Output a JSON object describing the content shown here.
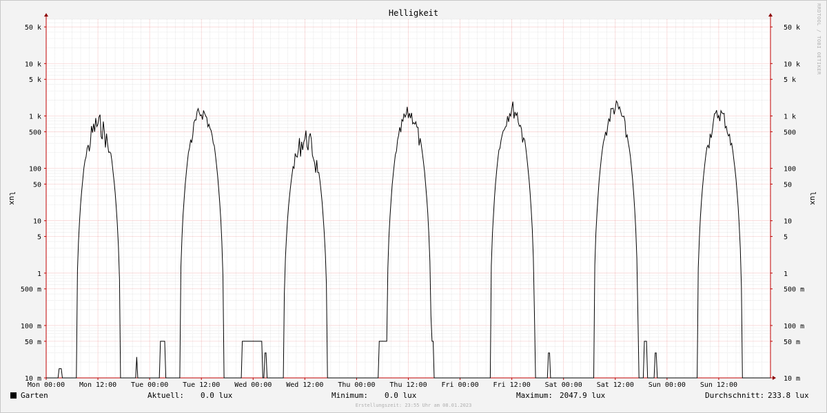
{
  "watermark": "RRDTOOL / TOBI OETIKER",
  "chart_data": {
    "type": "line",
    "title": "Helligkeit",
    "ylabel": "lux",
    "y_scale": "log",
    "ylim": [
      0.01,
      70000
    ],
    "xlim": [
      0,
      168
    ],
    "x_unit": "hours since Mon 00:00",
    "x_tick_labels": [
      "Mon 00:00",
      "Mon 12:00",
      "Tue 00:00",
      "Tue 12:00",
      "Wed 00:00",
      "Wed 12:00",
      "Thu 00:00",
      "Thu 12:00",
      "Fri 00:00",
      "Fri 12:00",
      "Sat 00:00",
      "Sat 12:00",
      "Sun 00:00",
      "Sun 12:00"
    ],
    "y_tick_labels": [
      "10 m",
      "50 m",
      "100 m",
      "500 m",
      "1",
      "5",
      "10",
      "50",
      "100",
      "500",
      "1 k",
      "5 k",
      "10 k",
      "50 k"
    ],
    "y_tick_values": [
      0.01,
      0.05,
      0.1,
      0.5,
      1,
      5,
      10,
      50,
      100,
      500,
      1000,
      5000,
      10000,
      50000
    ],
    "grid": true,
    "series": [
      {
        "name": "Garten",
        "color": "#000000",
        "days": [
          {
            "day": 0,
            "rise": 7.0,
            "set": 17.2,
            "peak": 1150,
            "noise": 0.45
          },
          {
            "day": 1,
            "rise": 7.0,
            "set": 17.2,
            "peak": 1650,
            "noise": 0.3
          },
          {
            "day": 2,
            "rise": 7.1,
            "set": 17.2,
            "peak": 600,
            "noise": 0.45
          },
          {
            "day": 3,
            "rise": 7.0,
            "set": 17.3,
            "peak": 1550,
            "noise": 0.3
          },
          {
            "day": 4,
            "rise": 7.0,
            "set": 17.3,
            "peak": 2000,
            "noise": 0.35
          },
          {
            "day": 5,
            "rise": 7.0,
            "set": 17.3,
            "peak": 2048,
            "noise": 0.3
          },
          {
            "day": 6,
            "rise": 7.0,
            "set": 17.4,
            "peak": 1550,
            "noise": 0.3
          }
        ],
        "night_values": [
          {
            "from": 2.9,
            "to": 3.5,
            "value": 0.015
          },
          {
            "from": 9.9,
            "to": 11.9,
            "value": 0.05
          },
          {
            "from": 20.9,
            "to": 21.1,
            "value": 0.025
          },
          {
            "from": 26.4,
            "to": 27.6,
            "value": 0.05
          },
          {
            "from": 45.3,
            "to": 50.0,
            "value": 0.05
          },
          {
            "from": 50.6,
            "to": 51.0,
            "value": 0.03
          },
          {
            "from": 60.7,
            "to": 63.2,
            "value": 0.05
          },
          {
            "from": 63.4,
            "to": 64.0,
            "value": 0.03
          },
          {
            "from": 77.1,
            "to": 79.7,
            "value": 0.05
          },
          {
            "from": 87.4,
            "to": 89.8,
            "value": 0.05
          },
          {
            "from": 103.7,
            "to": 104.3,
            "value": 0.05
          },
          {
            "from": 109.8,
            "to": 113.4,
            "value": 0.05
          },
          {
            "from": 116.4,
            "to": 116.8,
            "value": 0.03
          },
          {
            "from": 135.2,
            "to": 135.6,
            "value": 0.03
          },
          {
            "from": 138.7,
            "to": 139.4,
            "value": 0.05
          },
          {
            "from": 141.2,
            "to": 141.7,
            "value": 0.03
          }
        ]
      }
    ]
  },
  "legend": {
    "series_name": "Garten",
    "current_label": "Aktuell:",
    "current_value": "0.0 lux",
    "min_label": "Minimum:",
    "min_value": "0.0 lux",
    "max_label": "Maximum:",
    "max_value": "2047.9 lux",
    "avg_label": "Durchschnitt:",
    "avg_value": "233.8 lux"
  },
  "footer": "Erstellungszeit: 23:55 Uhr am 08.01.2023"
}
